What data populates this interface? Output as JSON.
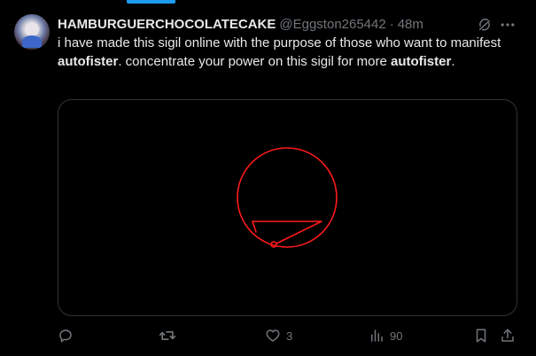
{
  "tweet": {
    "author_name": "HAMBURGUERCHOCOLATECAKE",
    "handle": "@Eggston265442",
    "separator": "·",
    "time": "48m",
    "text_part1": "i have made this sigil online with the purpose of those who want to manifest ",
    "bold1": "autofister",
    "text_part2": ". concentrate your power on this sigil for more ",
    "bold2": "autofister",
    "text_part3": "."
  },
  "actions": {
    "likes": "3",
    "views": "90"
  },
  "colors": {
    "accent": "#1d9bf0",
    "sigil": "#ff1a1a",
    "muted": "#71767b",
    "text": "#e7e9ea"
  },
  "icons": [
    "grok-icon",
    "more-icon",
    "reply-icon",
    "retweet-icon",
    "like-icon",
    "views-icon",
    "bookmark-icon",
    "share-icon"
  ]
}
